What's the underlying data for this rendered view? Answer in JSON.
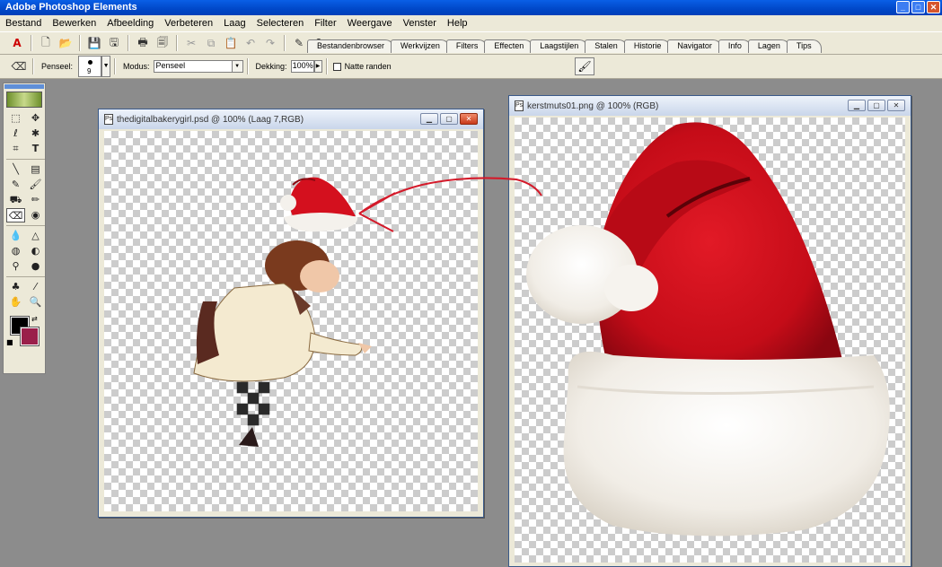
{
  "app": {
    "title": "Adobe Photoshop Elements",
    "controls": {
      "minimize": "_",
      "maximize": "□",
      "close": "✕"
    }
  },
  "menu": [
    "Bestand",
    "Bewerken",
    "Afbeelding",
    "Verbeteren",
    "Laag",
    "Selecteren",
    "Filter",
    "Weergave",
    "Venster",
    "Help"
  ],
  "palette_tabs": [
    "Bestandenbrowser",
    "Werkvijzen",
    "Filters",
    "Effecten",
    "Laagstijlen",
    "Stalen",
    "Historie",
    "Navigator",
    "Info",
    "Lagen",
    "Tips"
  ],
  "options": {
    "brush_label": "Penseel:",
    "brush_size": "9",
    "mode_label": "Modus:",
    "mode_value": "Penseel",
    "opacity_label": "Dekking:",
    "opacity_value": "100%",
    "wet_edges_label": "Natte randen"
  },
  "toolbox": {
    "foreground_color": "#000000",
    "background_color": "#9a1f4a"
  },
  "documents": [
    {
      "title": "thedigitalbakerygirl.psd @ 100% (Laag 7,RGB)"
    },
    {
      "title": "kerstmuts01.png @ 100% (RGB)"
    }
  ],
  "colors": {
    "hat_red": "#d4101e",
    "hat_fur": "#f4f1ec",
    "annotation_arrow": "#d41a2a"
  }
}
